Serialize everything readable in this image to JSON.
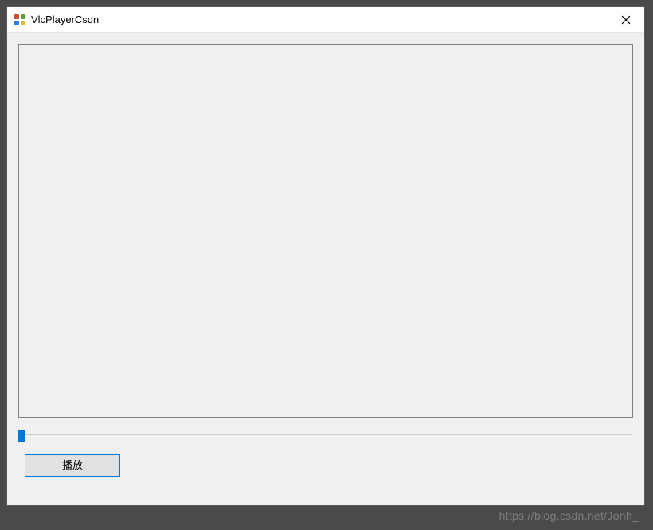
{
  "window": {
    "title": "VlcPlayerCsdn"
  },
  "controls": {
    "play_label": "播放"
  },
  "slider": {
    "value": 0
  },
  "watermark": "https://blog.csdn.net/Jonh_"
}
